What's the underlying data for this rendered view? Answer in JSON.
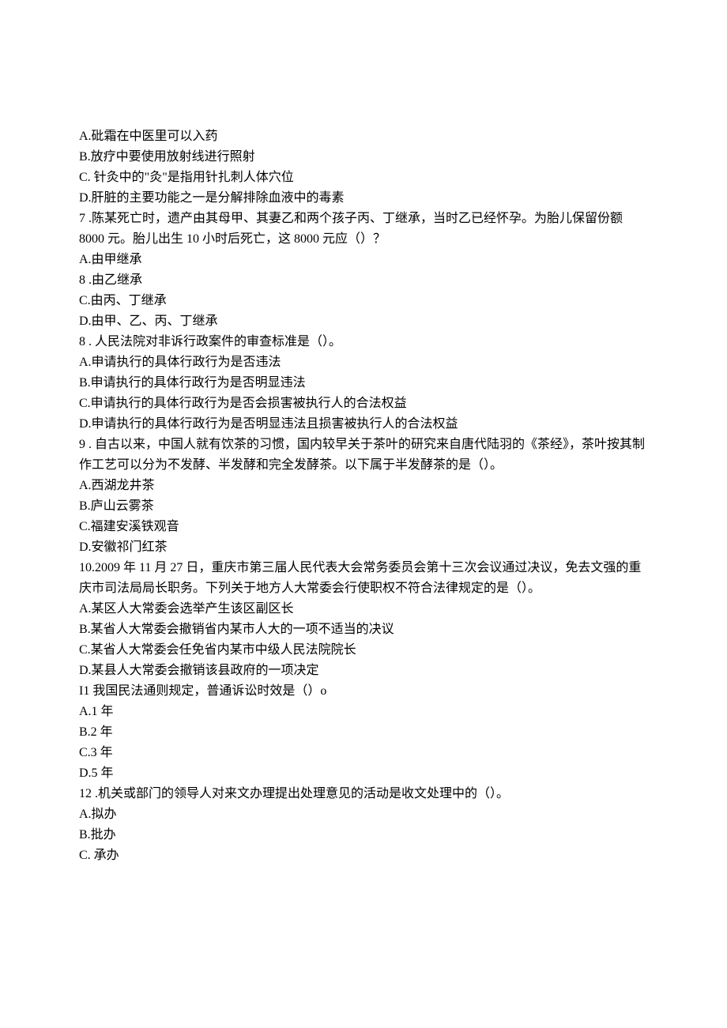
{
  "lines": [
    "A.砒霜在中医里可以入药",
    "B.放疗中要使用放射线进行照射",
    "C. 针灸中的\"灸\"是指用针扎刺人体穴位",
    "D.肝脏的主要功能之一是分解排除血液中的毒素",
    "7 .陈某死亡时，遗产由其母甲、其妻乙和两个孩子丙、丁继承，当时乙已经怀孕。为胎儿保留份额 8000 元。胎儿出生 10 小时后死亡，这 8000 元应（）？",
    "A.由甲继承",
    "8 .由乙继承",
    "C.由丙、丁继承",
    "D.由甲、乙、丙、丁继承",
    "8 . 人民法院对非诉行政案件的审查标准是（）。",
    "A.申请执行的具体行政行为是否违法",
    "B.申请执行的具体行政行为是否明显违法",
    "C.申请执行的具体行政行为是否会损害被执行人的合法权益",
    "D.申请执行的具体行政行为是否明显违法且损害被执行人的合法权益",
    "9 . 自古以来，中国人就有饮茶的习惯，国内较早关于茶叶的研究来自唐代陆羽的《茶经》，茶叶按其制作工艺可以分为不发酵、半发酵和完全发酵茶。以下属于半发酵茶的是（）。",
    "A.西湖龙井茶",
    "B.庐山云雾茶",
    "C.福建安溪铁观音",
    "D.安徽祁门红茶",
    "10.2009 年 11 月 27 日，重庆市第三届人民代表大会常务委员会第十三次会议通过决议，免去文强的重庆市司法局局长职务。下列关于地方人大常委会行使职权不符合法律规定的是（）。",
    "A.某区人大常委会选举产生该区副区长",
    "B.某省人大常委会撤销省内某市人大的一项不适当的决议",
    "C.某省人大常委会任免省内某市中级人民法院院长",
    "D.某县人大常委会撤销该县政府的一项决定",
    "I1 我国民法通则规定，普通诉讼时效是（）o",
    "A.1 年",
    "B.2 年",
    "C.3 年",
    "D.5 年",
    "12 .机关或部门的领导人对来文办理提出处理意见的活动是收文处理中的（）。",
    "A.拟办",
    "B.批办",
    "C. 承办"
  ]
}
